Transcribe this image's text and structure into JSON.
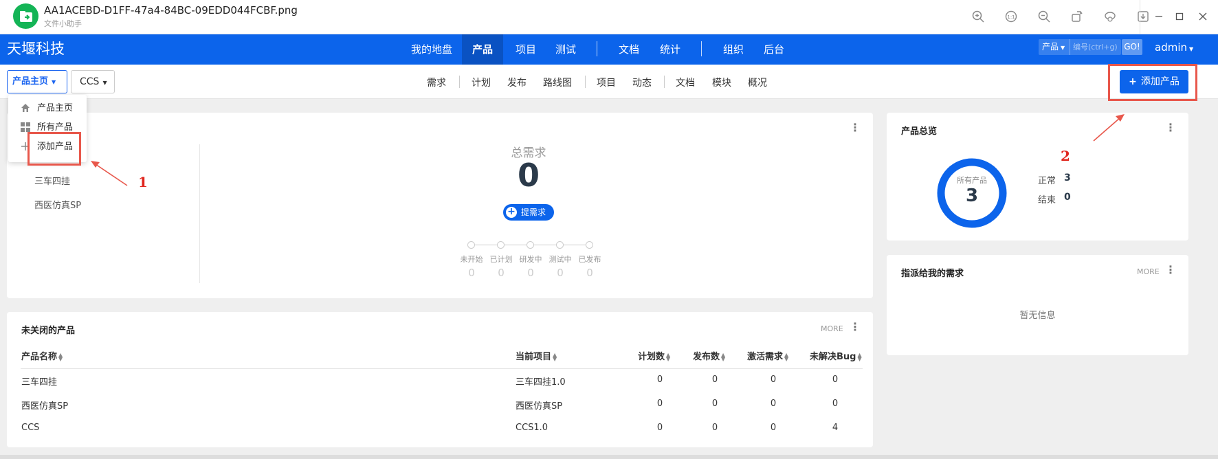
{
  "titlebar": {
    "filename": "AA1ACEBD-D1FF-47a4-84BC-09EDD044FCBF.png",
    "subtitle": "文件小助手",
    "tools": [
      "zoom-in-icon",
      "actual-size-icon",
      "zoom-out-icon",
      "rotate-icon",
      "share-icon",
      "download-icon"
    ],
    "actual_size_label": "1:1"
  },
  "nav": {
    "brand": "天堰科技",
    "items": [
      "我的地盘",
      "产品",
      "项目",
      "测试",
      "文档",
      "统计",
      "组织",
      "后台"
    ],
    "active_index": 1,
    "search_type": "产品",
    "search_placeholder": "编号(ctrl+g)",
    "search_go": "GO!",
    "user": "admin"
  },
  "subnav": {
    "crumb_product_home": "产品主页",
    "crumb_product": "CCS",
    "items": [
      "需求",
      "计划",
      "发布",
      "路线图",
      "项目",
      "动态",
      "文档",
      "模块",
      "概况"
    ],
    "add_product": "添加产品"
  },
  "dropdown": {
    "items": [
      "产品主页",
      "所有产品",
      "添加产品"
    ]
  },
  "product_list": [
    "三车四挂",
    "西医仿真SP"
  ],
  "summary": {
    "total_label": "总需求",
    "total_value": "0",
    "submit_label": "提需求",
    "stages": [
      {
        "label": "未开始",
        "value": "0"
      },
      {
        "label": "已计划",
        "value": "0"
      },
      {
        "label": "研发中",
        "value": "0"
      },
      {
        "label": "测试中",
        "value": "0"
      },
      {
        "label": "已发布",
        "value": "0"
      }
    ]
  },
  "overview": {
    "title": "产品总览",
    "ring_label": "所有产品",
    "ring_value": "3",
    "normal_label": "正常",
    "normal_value": "3",
    "closed_label": "结束",
    "closed_value": "0",
    "ring_color": "#0c64eb"
  },
  "assigned": {
    "title": "指派给我的需求",
    "more": "MORE",
    "empty": "暂无信息"
  },
  "products_table": {
    "title": "未关闭的产品",
    "more": "MORE",
    "headers": [
      "产品名称",
      "当前项目",
      "计划数",
      "发布数",
      "激活需求",
      "未解决Bug"
    ],
    "rows": [
      [
        "三车四挂",
        "三车四挂1.0",
        "0",
        "0",
        "0",
        "0"
      ],
      [
        "西医仿真SP",
        "西医仿真SP",
        "0",
        "0",
        "0",
        "0"
      ],
      [
        "CCS",
        "CCS1.0",
        "0",
        "0",
        "0",
        "4"
      ]
    ]
  },
  "annotations": {
    "one": "1",
    "two": "2",
    "color": "#e8574b"
  },
  "colors": {
    "primary": "#0c64eb",
    "app_logo": "#14b456"
  }
}
